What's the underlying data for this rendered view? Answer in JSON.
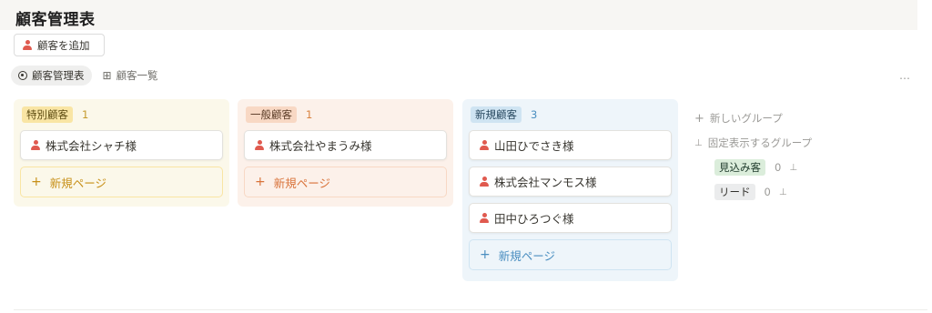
{
  "header": {
    "title": "顧客管理表",
    "add_button": "顧客を追加"
  },
  "tabs": [
    {
      "label": "顧客管理表",
      "icon": "person-circle-icon",
      "active": true
    },
    {
      "label": "顧客一覧",
      "icon": "table-icon",
      "active": false
    }
  ],
  "more_icon": "…",
  "columns": [
    {
      "tag": "特別顧客",
      "count": "1",
      "colors": {
        "bg": "#fbf8ea",
        "tag_bg": "#f9e5a4",
        "tag_fg": "#5c4b10",
        "count": "#c49a2b",
        "new": "#c78f17"
      },
      "cards": [
        "株式会社シャチ様"
      ],
      "new_label": "新規ページ"
    },
    {
      "tag": "一般顧客",
      "count": "1",
      "colors": {
        "bg": "#fcf1ea",
        "tag_bg": "#f8d8c4",
        "tag_fg": "#5a3b26",
        "count": "#d9823f",
        "new": "#d9733a"
      },
      "cards": [
        "株式会社やまうみ様"
      ],
      "new_label": "新規ページ"
    },
    {
      "tag": "新規顧客",
      "count": "3",
      "colors": {
        "bg": "#eef5fa",
        "tag_bg": "#cfe4f2",
        "tag_fg": "#25465d",
        "count": "#4a8ec0",
        "new": "#4a8ec0"
      },
      "cards": [
        "山田ひでさき様",
        "株式会社マンモス様",
        "田中ひろつぐ様"
      ],
      "new_label": "新規ページ"
    }
  ],
  "side": {
    "new_group": "新しいグループ",
    "pinned_heading": "固定表示するグループ",
    "groups": [
      {
        "tag": "見込み客",
        "count": "0",
        "tag_bg": "#dbeddb",
        "tag_fg": "#1c3829"
      },
      {
        "tag": "リード",
        "count": "0",
        "tag_bg": "#ebeced",
        "tag_fg": "#32302c"
      }
    ]
  }
}
